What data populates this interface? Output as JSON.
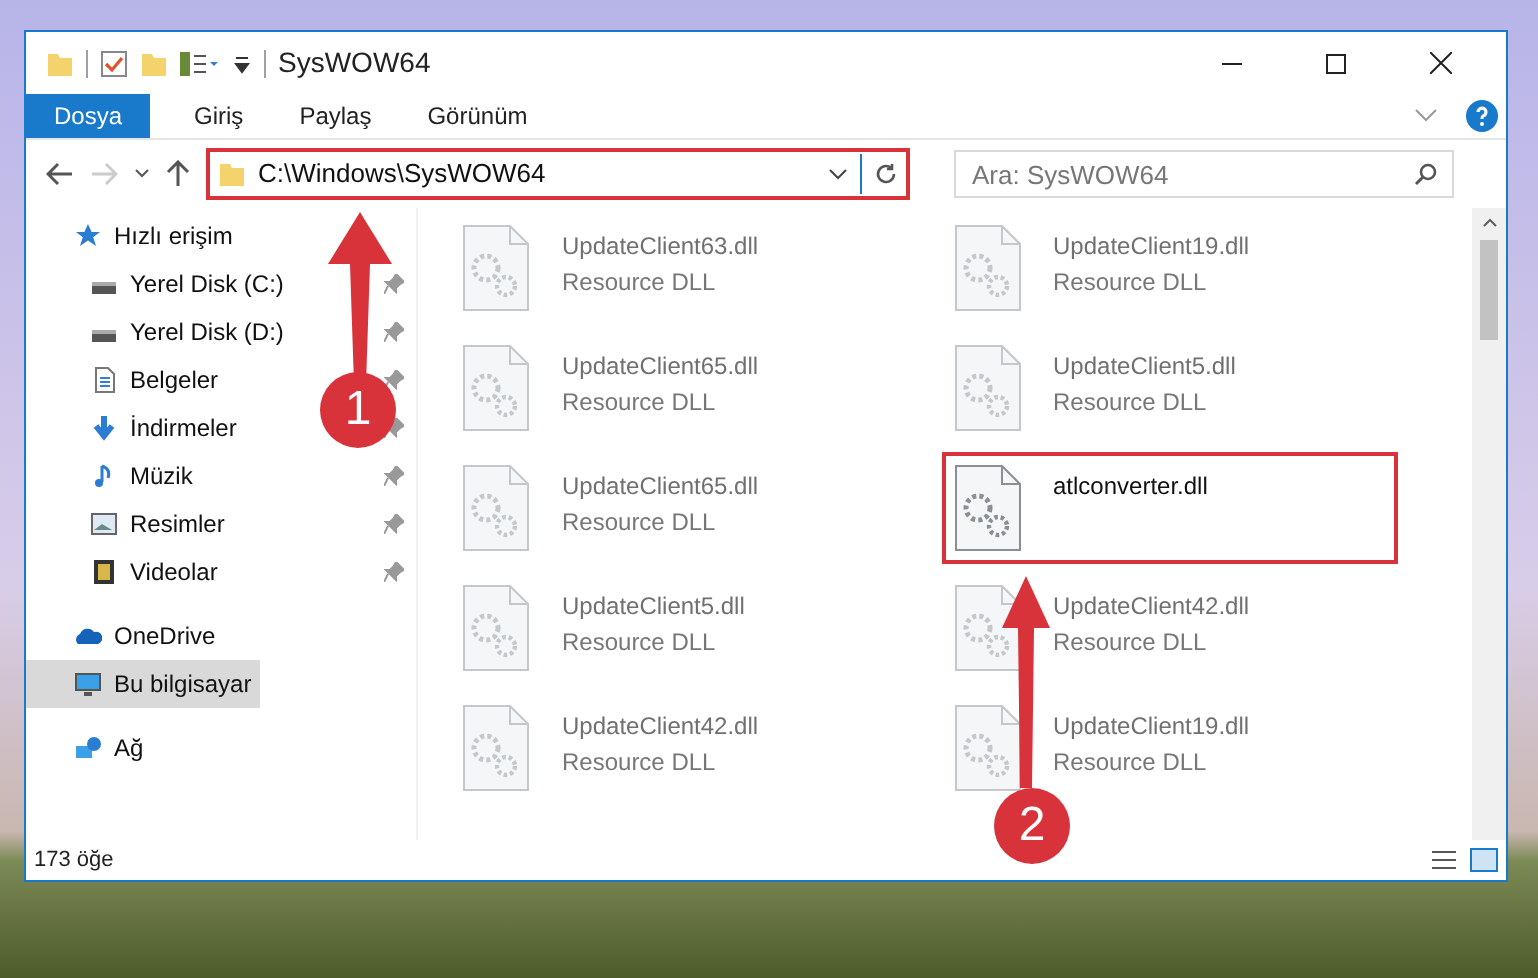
{
  "window": {
    "title": "SysWOW64"
  },
  "ribbon_tabs": [
    {
      "label": "Dosya",
      "selected": true
    },
    {
      "label": "Giriş",
      "selected": false
    },
    {
      "label": "Paylaş",
      "selected": false
    },
    {
      "label": "Görünüm",
      "selected": false
    }
  ],
  "address": {
    "value": "C:\\Windows\\SysWOW64",
    "highlighted": true
  },
  "search": {
    "placeholder": "Ara: SysWOW64"
  },
  "sidebar": {
    "items": [
      {
        "label": "Hızlı erişim",
        "kind": "quick",
        "selected": false,
        "children": [
          {
            "label": "Yerel Disk (C:)",
            "kind": "disk",
            "pinned": true,
            "selected": false
          },
          {
            "label": "Yerel Disk (D:)",
            "kind": "disk",
            "pinned": true,
            "selected": false
          },
          {
            "label": "Belgeler",
            "kind": "docs",
            "pinned": true,
            "selected": false
          },
          {
            "label": "İndirmeler",
            "kind": "download",
            "pinned": true,
            "selected": false
          },
          {
            "label": "Müzik",
            "kind": "music",
            "pinned": true,
            "selected": false
          },
          {
            "label": "Resimler",
            "kind": "pictures",
            "pinned": true,
            "selected": false
          },
          {
            "label": "Videolar",
            "kind": "videos",
            "pinned": true,
            "selected": false
          }
        ]
      },
      {
        "label": "OneDrive",
        "kind": "cloud",
        "selected": false
      },
      {
        "label": "Bu bilgisayar",
        "kind": "pc",
        "selected": true
      },
      {
        "label": "Ağ",
        "kind": "network",
        "selected": false
      }
    ]
  },
  "files": [
    {
      "name": "UpdateClient63.dll",
      "type": "Resource DLL",
      "blurred": true,
      "highlighted": false
    },
    {
      "name": "UpdateClient19.dll",
      "type": "Resource DLL",
      "blurred": true,
      "highlighted": false
    },
    {
      "name": "UpdateClient65.dll",
      "type": "Resource DLL",
      "blurred": true,
      "highlighted": false
    },
    {
      "name": "UpdateClient5.dll",
      "type": "Resource DLL",
      "blurred": true,
      "highlighted": false
    },
    {
      "name": "UpdateClient65.dll",
      "type": "Resource DLL",
      "blurred": true,
      "highlighted": false
    },
    {
      "name": "atlconverter.dll",
      "blurred": false,
      "highlighted": true
    },
    {
      "name": "UpdateClient5.dll",
      "type": "Resource DLL",
      "blurred": true,
      "highlighted": false
    },
    {
      "name": "UpdateClient42.dll",
      "type": "Resource DLL",
      "blurred": true,
      "highlighted": false
    },
    {
      "name": "UpdateClient42.dll",
      "type": "Resource DLL",
      "blurred": true,
      "highlighted": false
    },
    {
      "name": "UpdateClient19.dll",
      "type": "Resource DLL",
      "blurred": true,
      "highlighted": false
    }
  ],
  "status_bar": {
    "count": "173 öğe"
  },
  "annotations": [
    {
      "label": "1"
    },
    {
      "label": "2"
    }
  ]
}
